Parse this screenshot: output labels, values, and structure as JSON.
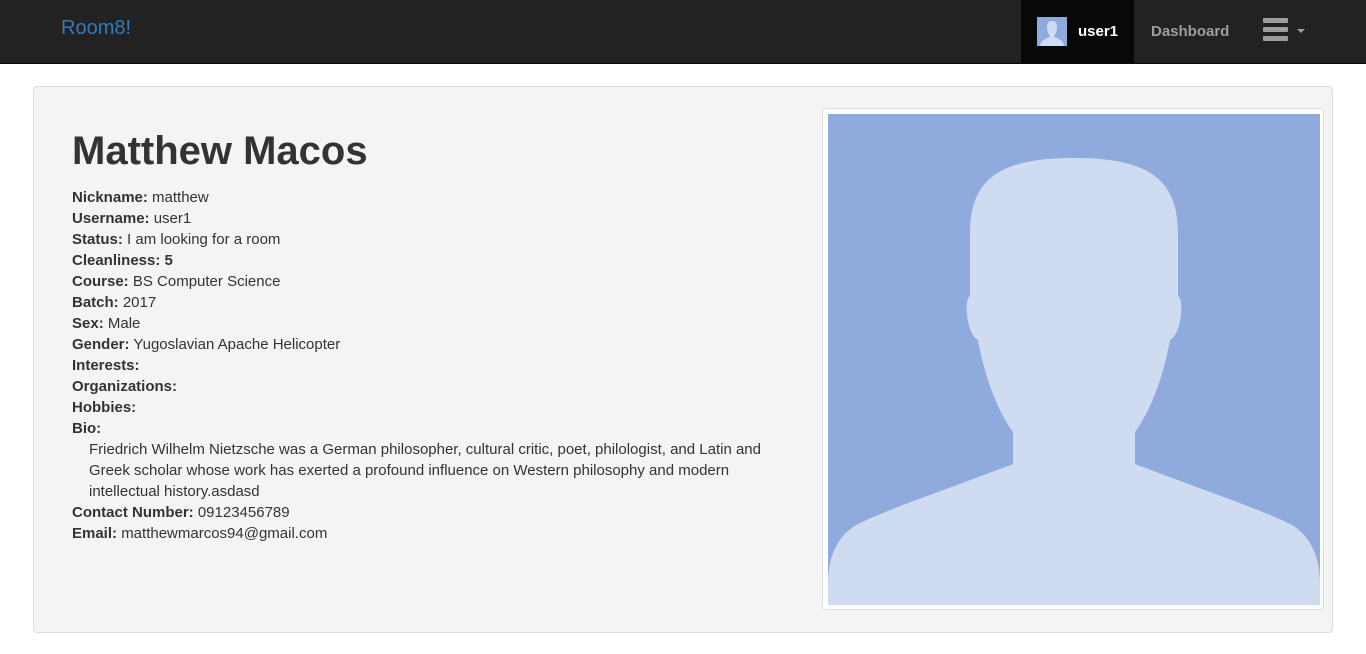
{
  "navbar": {
    "brand": "Room8!",
    "user_label": "user1",
    "dashboard_label": "Dashboard"
  },
  "profile": {
    "name": "Matthew Macos",
    "fields": {
      "nickname_label": "Nickname:",
      "nickname": "matthew",
      "username_label": "Username:",
      "username": "user1",
      "status_label": "Status:",
      "status": "I am looking for a room",
      "cleanliness_label": "Cleanliness:",
      "cleanliness": "5",
      "course_label": "Course:",
      "course": "BS Computer Science",
      "batch_label": "Batch:",
      "batch": "2017",
      "sex_label": "Sex:",
      "sex": "Male",
      "gender_label": "Gender:",
      "gender": "Yugoslavian Apache Helicopter",
      "interests_label": "Interests:",
      "organizations_label": "Organizations:",
      "hobbies_label": "Hobbies:",
      "bio_label": "Bio:",
      "bio": "Friedrich Wilhelm Nietzsche was a German philosopher, cultural critic, poet, philologist, and Latin and Greek scholar whose work has exerted a profound influence on Western philosophy and modern intellectual history.asdasd",
      "contact_label": "Contact Number:",
      "contact": "09123456789",
      "email_label": "Email:",
      "email": "matthewmarcos94@gmail.com"
    }
  },
  "icons": {
    "menu": "hamburger-menu-icon",
    "avatar": "default-avatar-silhouette"
  },
  "colors": {
    "navbar_bg": "#222222",
    "brand": "#337ab7",
    "avatar_bg": "#8faadc",
    "avatar_silhouette": "#cfdbf1"
  }
}
